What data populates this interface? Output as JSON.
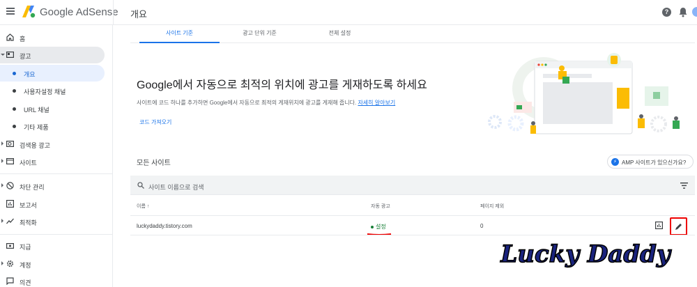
{
  "header": {
    "product_name": "Google AdSense",
    "page_title": "개요",
    "help_glyph": "?"
  },
  "sidebar": {
    "items": [
      {
        "label": "홈",
        "icon": "home-icon"
      },
      {
        "label": "광고",
        "icon": "ads-icon"
      },
      {
        "label": "개요"
      },
      {
        "label": "사용자설정 채널"
      },
      {
        "label": "URL 채널"
      },
      {
        "label": "기타 제품"
      },
      {
        "label": "검색용 광고",
        "icon": "search-ads-icon"
      },
      {
        "label": "사이트",
        "icon": "sites-icon"
      },
      {
        "label": "차단 관리",
        "icon": "block-icon"
      },
      {
        "label": "보고서",
        "icon": "reports-icon"
      },
      {
        "label": "최적화",
        "icon": "trend-icon"
      },
      {
        "label": "지급",
        "icon": "payments-icon"
      },
      {
        "label": "계정",
        "icon": "gear-icon"
      },
      {
        "label": "의견",
        "icon": "feedback-icon"
      }
    ]
  },
  "tabs": [
    "사이트 기준",
    "광고 단위 기준",
    "전체 설정"
  ],
  "hero": {
    "title": "Google에서 자동으로 최적의 위치에 광고를 게재하도록 하세요",
    "description": "사이트에 코드 하나를 추가하면 Google에서 자동으로 최적의 게재위치에 광고를 게재해 줍니다.",
    "learn_more": "자세히 알아보기",
    "get_code": "코드 가져오기"
  },
  "sites": {
    "title": "모든 사이트",
    "amp_chip": "AMP 사이트가 있으신가요?",
    "amp_icon_glyph": "⚡",
    "search_placeholder": "사이트 이름으로 검색",
    "columns": {
      "name": "이름 ↑",
      "auto_ads": "자동 광고",
      "page_exclusions": "페이지 제외"
    },
    "rows": [
      {
        "name": "luckydaddy.tistory.com",
        "auto_ads": "설정",
        "page_exclusions": "0"
      }
    ]
  },
  "watermark": {
    "text": "Lucky Daddy"
  },
  "colors": {
    "accent": "#1a73e8",
    "status_on": "#188038",
    "highlight": "#e00000"
  }
}
